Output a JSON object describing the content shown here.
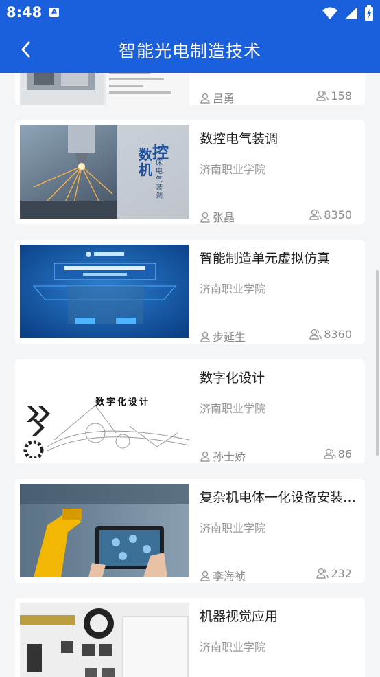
{
  "status_bar": {
    "time": "8:48",
    "notification_icon": "A"
  },
  "header": {
    "title": "智能光电制造技术"
  },
  "courses": [
    {
      "title": "",
      "school": "",
      "teacher": "吕勇",
      "count": "158"
    },
    {
      "title": "数控电气装调",
      "school": "济南职业学院",
      "teacher": "张晶",
      "count": "8350",
      "thumb_text_large": "控",
      "thumb_text_left": "数机",
      "thumb_text_small": "床电气装调"
    },
    {
      "title": "智能制造单元虚拟仿真",
      "school": "济南职业学院",
      "teacher": "步延生",
      "count": "8360"
    },
    {
      "title": "数字化设计",
      "school": "济南职业学院",
      "teacher": "孙士娇",
      "count": "86",
      "thumb_caption": "数字化设计"
    },
    {
      "title": "复杂机电体一化设备安装与调试",
      "school": "济南职业学院",
      "teacher": "李海祯",
      "count": "232"
    },
    {
      "title": "机器视觉应用",
      "school": "济南职业学院"
    }
  ]
}
